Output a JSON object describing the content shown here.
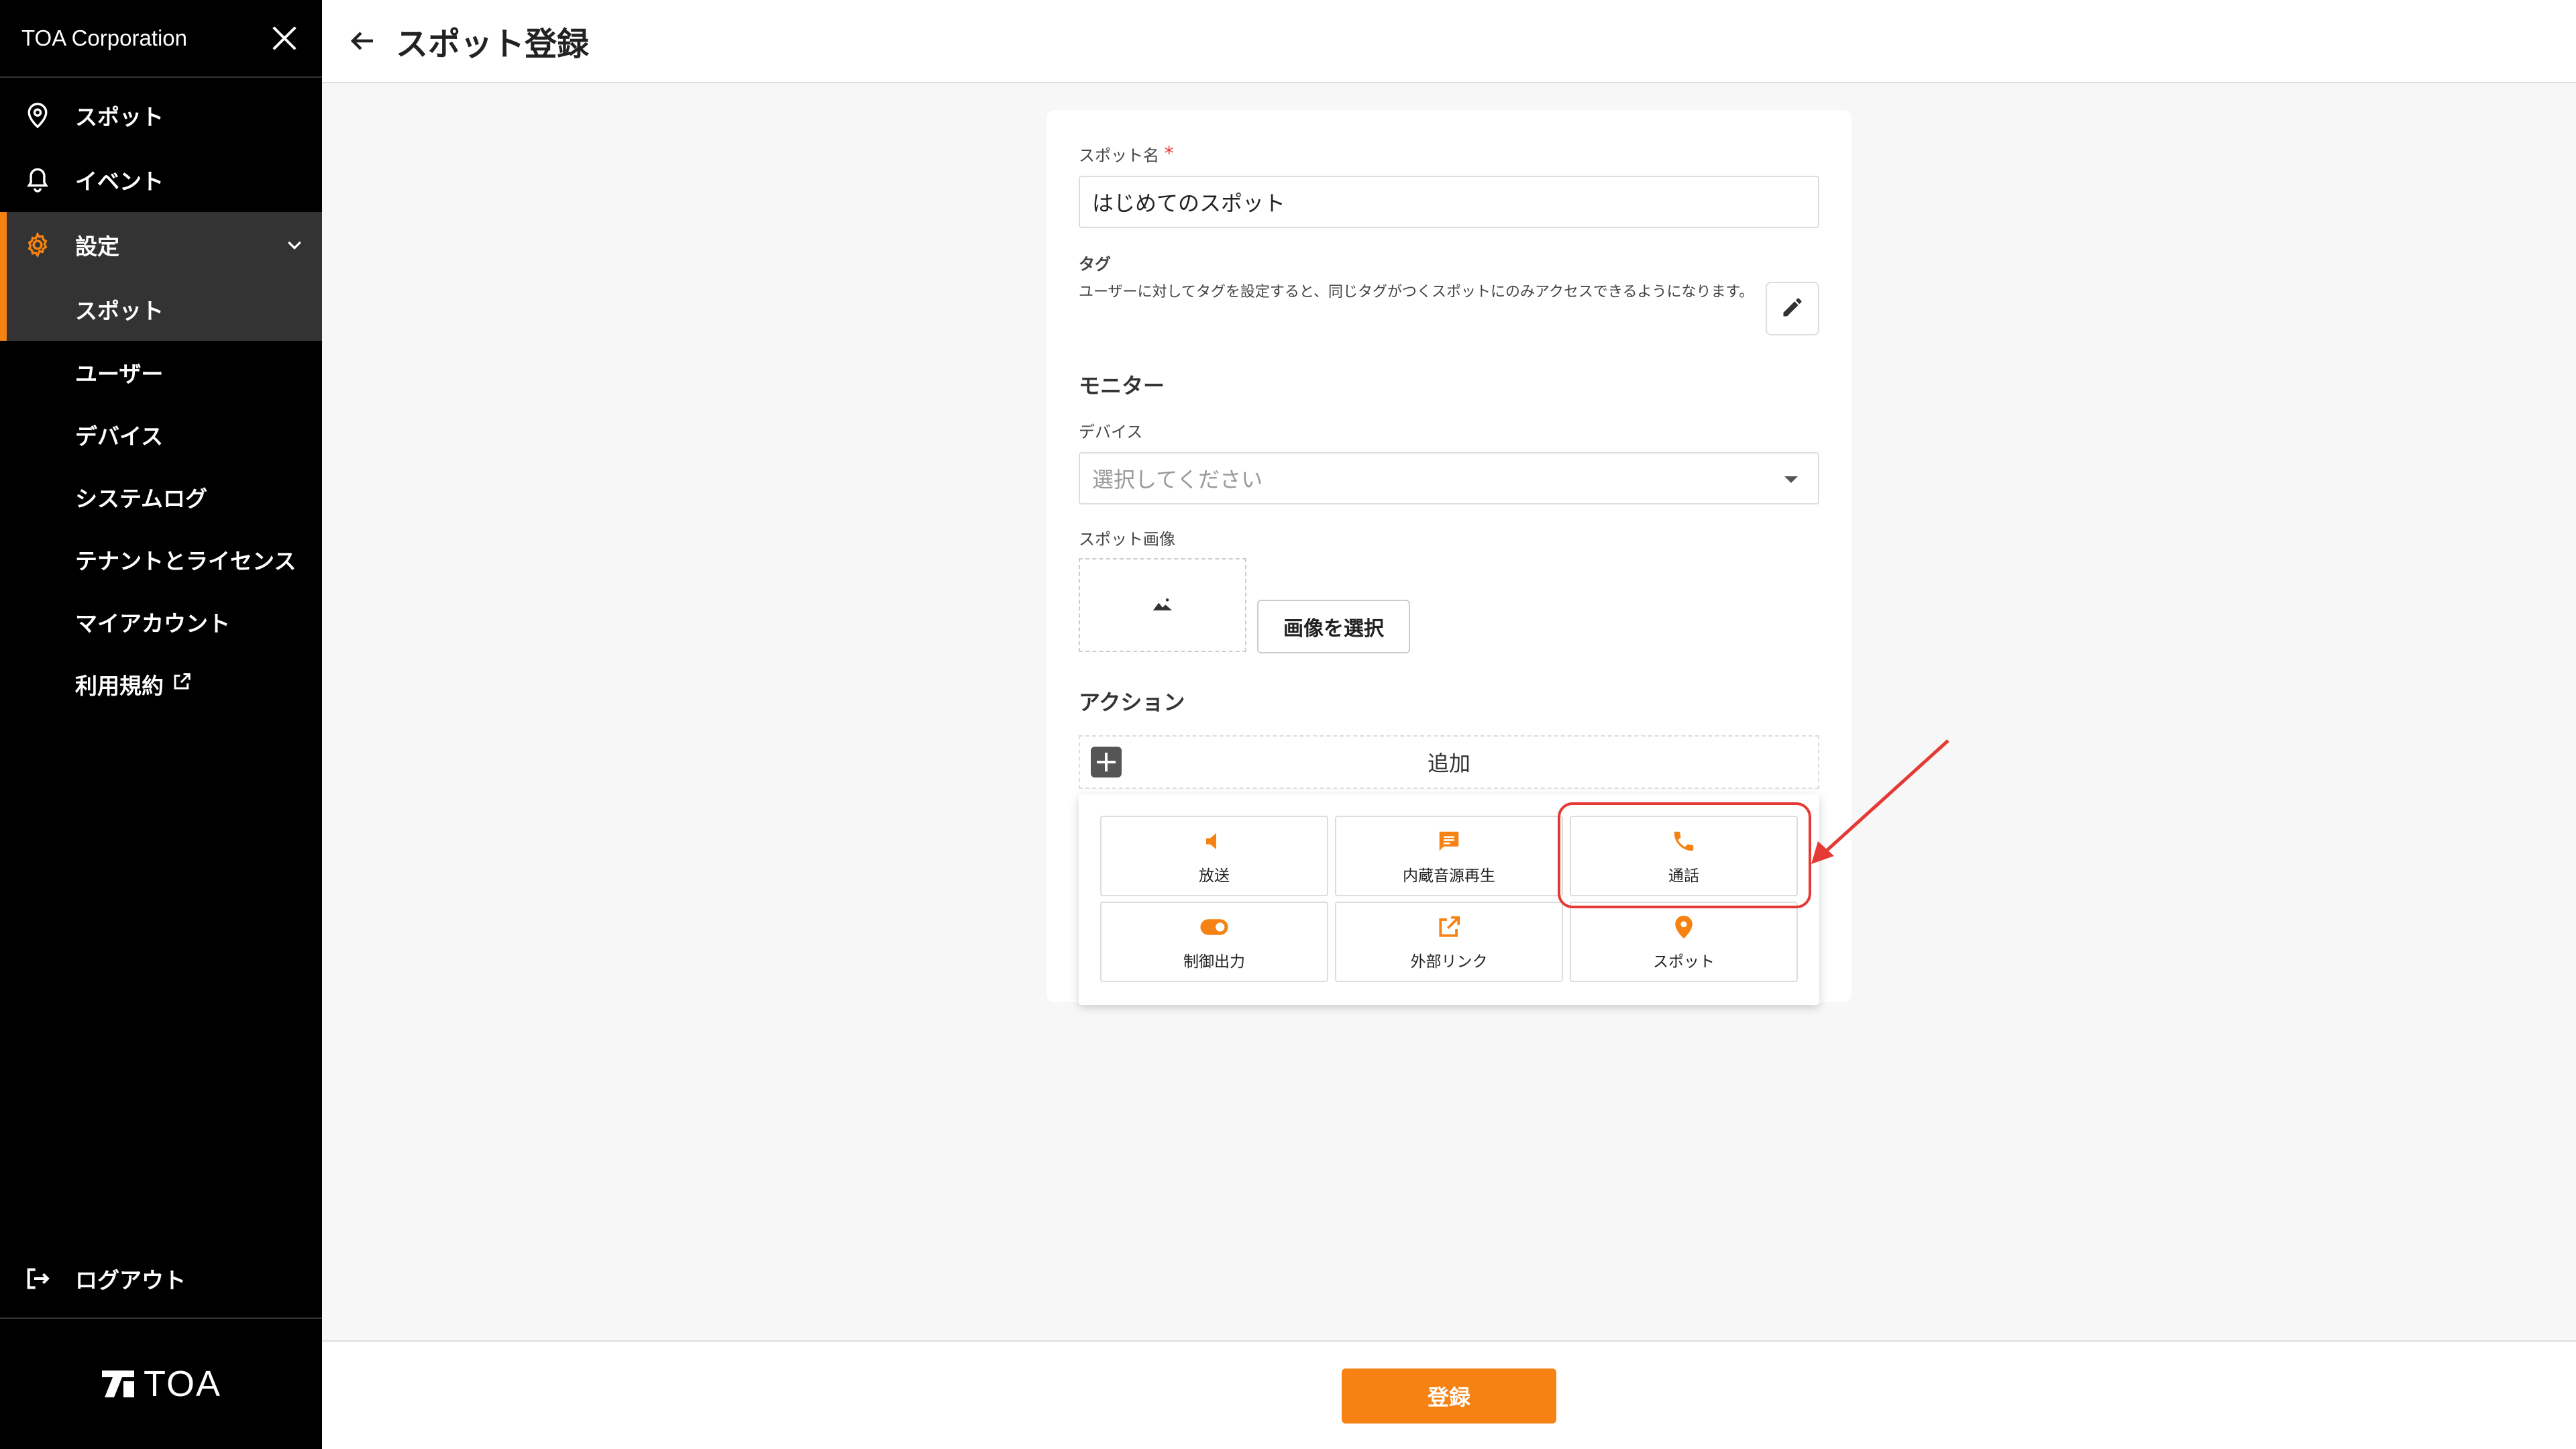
{
  "sidebar": {
    "org_name": "TOA Corporation",
    "nav": [
      {
        "label": "スポット",
        "icon": "location-pin-icon"
      },
      {
        "label": "イベント",
        "icon": "bell-icon"
      }
    ],
    "settings": {
      "label": "設定",
      "icon": "gear-icon",
      "sub_items": [
        "スポット",
        "ユーザー",
        "デバイス",
        "システムログ",
        "テナントとライセンス",
        "マイアカウント",
        "利用規約"
      ]
    },
    "logout": "ログアウト",
    "logo_text": "TOA"
  },
  "header": {
    "title": "スポット登録"
  },
  "form": {
    "spot_name_label": "スポット名",
    "required_mark": "*",
    "spot_name_value": "はじめてのスポット",
    "tag_label": "タグ",
    "tag_description": "ユーザーに対してタグを設定すると、同じタグがつくスポットにのみアクセスできるようになります。",
    "monitor_title": "モニター",
    "device_label": "デバイス",
    "device_placeholder": "選択してください",
    "spot_image_label": "スポット画像",
    "select_image_button": "画像を選択",
    "action_title": "アクション",
    "add_label": "追加"
  },
  "actions": [
    {
      "label": "放送",
      "icon": "speaker-icon"
    },
    {
      "label": "内蔵音源再生",
      "icon": "message-icon"
    },
    {
      "label": "通話",
      "icon": "phone-icon"
    },
    {
      "label": "制御出力",
      "icon": "toggle-icon"
    },
    {
      "label": "外部リンク",
      "icon": "external-link-icon"
    },
    {
      "label": "スポット",
      "icon": "location-pin-icon"
    }
  ],
  "footer": {
    "submit_label": "登録"
  },
  "colors": {
    "accent": "#f58212",
    "highlight": "#e53935",
    "sidebar_bg": "#000000"
  }
}
